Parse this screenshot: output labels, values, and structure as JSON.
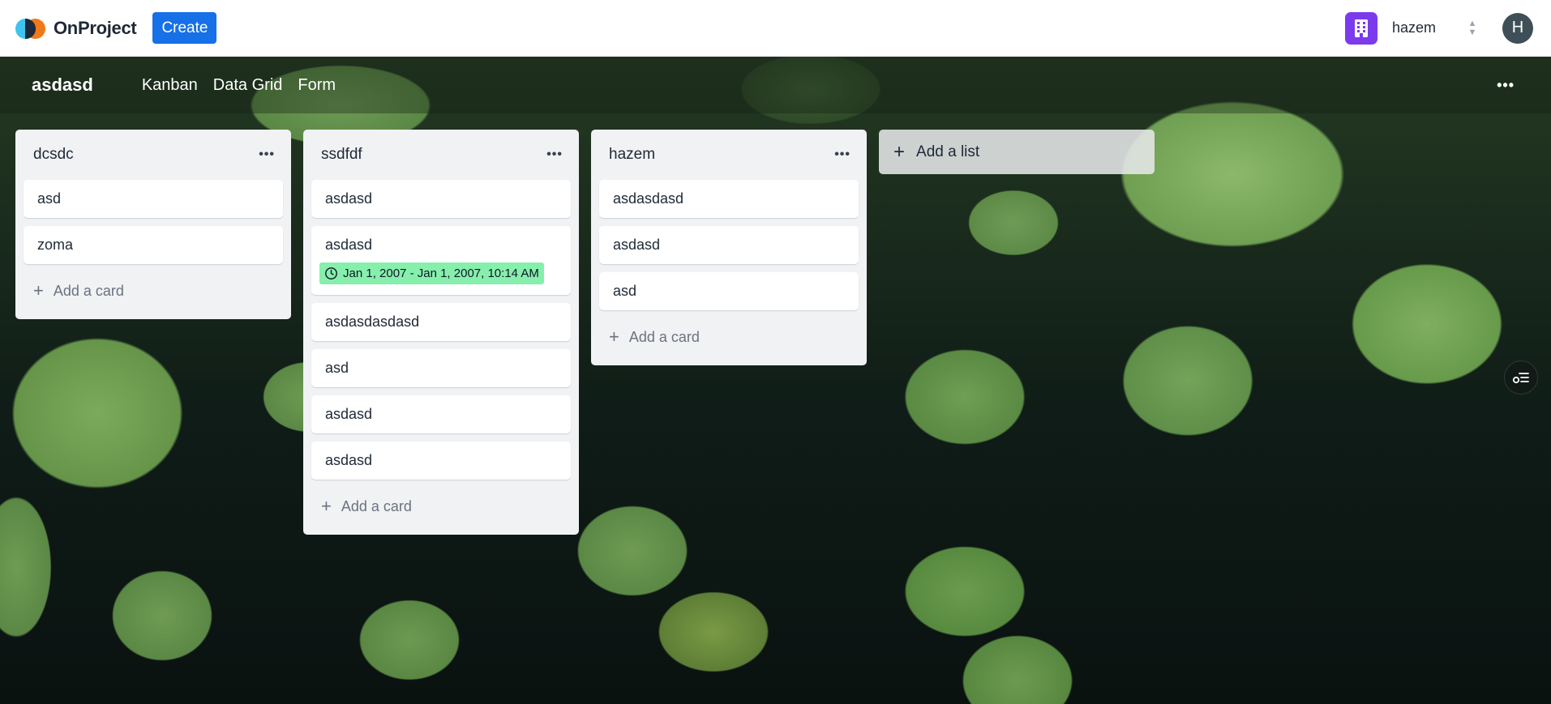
{
  "app": {
    "name": "OnProject",
    "create_label": "Create"
  },
  "workspace": {
    "name": "hazem",
    "avatar_initial": "H",
    "icon": "building-icon",
    "accent": "#7c3aed"
  },
  "board": {
    "title": "asdasd",
    "views": [
      "Kanban",
      "Data Grid",
      "Form"
    ],
    "menu_icon": "more-horizontal-icon"
  },
  "lists": [
    {
      "title": "dcsdc",
      "cards": [
        {
          "title": "asd"
        },
        {
          "title": "zoma"
        }
      ],
      "add_card_label": "Add a card"
    },
    {
      "title": "ssdfdf",
      "cards": [
        {
          "title": "asdasd"
        },
        {
          "title": "asdasd",
          "date_badge": "Jan 1, 2007 - Jan 1, 2007, 10:14 AM"
        },
        {
          "title": "asdasdasdasd"
        },
        {
          "title": "asd"
        },
        {
          "title": "asdasd"
        },
        {
          "title": "asdasd"
        }
      ],
      "add_card_label": "Add a card"
    },
    {
      "title": "hazem",
      "cards": [
        {
          "title": "asdasdasd"
        },
        {
          "title": "asdasd"
        },
        {
          "title": "asd"
        }
      ],
      "add_card_label": "Add a card"
    }
  ],
  "add_list_label": "Add a list",
  "colors": {
    "primary": "#1670e8",
    "badge": "#86efac",
    "list_bg": "#f1f2f4"
  }
}
